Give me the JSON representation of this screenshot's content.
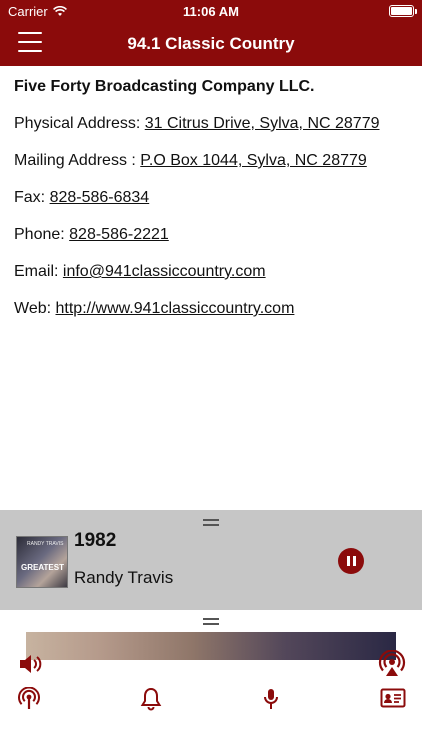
{
  "status_bar": {
    "carrier": "Carrier",
    "time": "11:06 AM",
    "wifi_icon": "wifi-icon",
    "battery_icon": "battery-icon"
  },
  "nav": {
    "title": "94.1 Classic Country",
    "menu_icon": "hamburger-menu-icon"
  },
  "contact": {
    "company": "Five Forty Broadcasting Company LLC.",
    "physical_label": "Physical Address: ",
    "physical_value": "31 Citrus Drive, Sylva, NC 28779",
    "mailing_label": "Mailing Address : ",
    "mailing_value": "P.O Box 1044, Sylva, NC 28779",
    "fax_label": "Fax: ",
    "fax_value": "828-586-6834",
    "phone_label": "Phone: ",
    "phone_value": "828-586-2221",
    "email_label": "Email: ",
    "email_value": "info@941classiccountry.com",
    "web_label": "Web: ",
    "web_value": "http://www.941classiccountry.com"
  },
  "player": {
    "song": "1982",
    "artist": "Randy Travis",
    "album_top_text": "RANDY TRAVIS",
    "album_text": "GREATEST",
    "pause_icon": "pause-icon"
  },
  "controls": {
    "volume_icon": "volume-icon",
    "airplay_icon": "airplay-icon"
  },
  "bottom_nav": [
    {
      "icon": "radio-broadcast-icon"
    },
    {
      "icon": "bell-icon"
    },
    {
      "icon": "microphone-icon"
    },
    {
      "icon": "contact-card-icon"
    }
  ],
  "colors": {
    "brand": "#8b0b0b",
    "player_bg": "#c6c6c6"
  }
}
